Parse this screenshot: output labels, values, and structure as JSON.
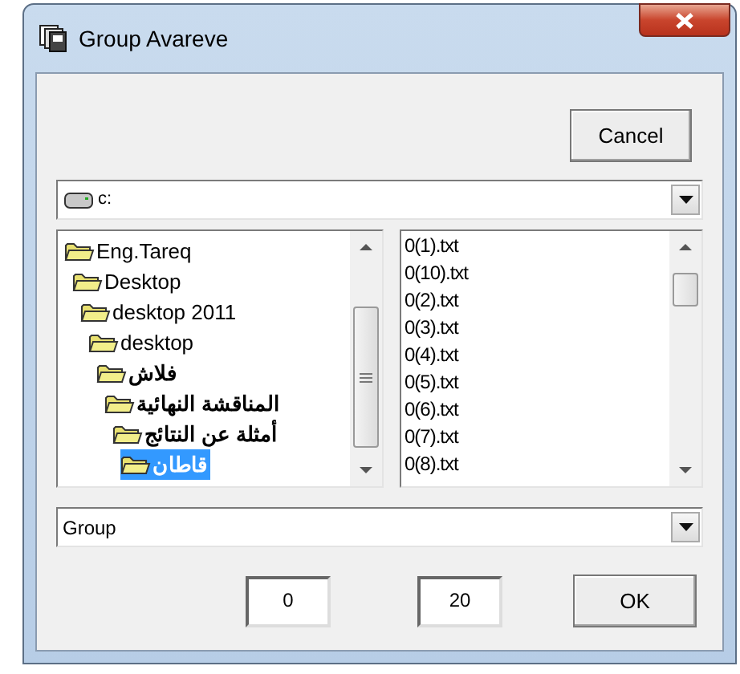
{
  "window": {
    "title": "Group Avareve"
  },
  "cancel_button": "Cancel",
  "drive_combo": {
    "value": "c:"
  },
  "folders": [
    {
      "label": "Eng.Tareq",
      "selected": false,
      "children": [
        {
          "label": "Desktop",
          "selected": false,
          "children": [
            {
              "label": "desktop 2011",
              "selected": false,
              "children": [
                {
                  "label": "desktop",
                  "selected": false,
                  "children": [
                    {
                      "label": "فلاش",
                      "selected": false,
                      "children": [
                        {
                          "label": "المناقشة النهائية",
                          "selected": false,
                          "children": [
                            {
                              "label": "أمثلة عن النتائج",
                              "selected": false,
                              "children": [
                                {
                                  "label": "قاطان",
                                  "selected": true
                                }
                              ]
                            }
                          ]
                        }
                      ]
                    }
                  ]
                }
              ]
            }
          ]
        }
      ]
    }
  ],
  "files": [
    "0(1).txt",
    "0(10).txt",
    "0(2).txt",
    "0(3).txt",
    "0(4).txt",
    "0(5).txt",
    "0(6).txt",
    "0(7).txt",
    "0(8).txt"
  ],
  "group_combo": {
    "value": "Group"
  },
  "fields": [
    "0",
    "20"
  ],
  "ok_button": "OK"
}
